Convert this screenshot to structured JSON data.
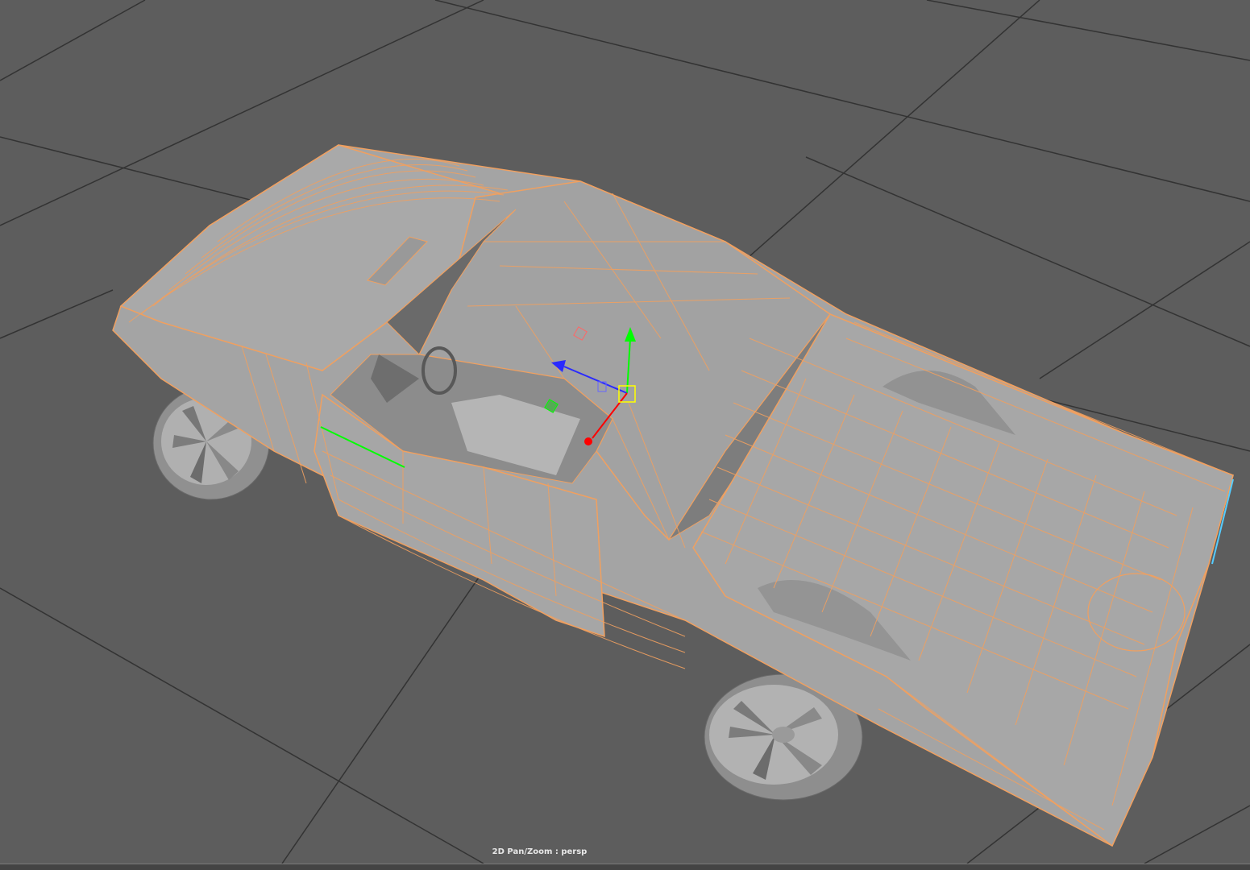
{
  "viewport": {
    "status_label": "2D Pan/Zoom : persp",
    "camera": "persp"
  },
  "colors": {
    "background": "#5d5d5d",
    "grid": "#333333",
    "wireframe": "#f0a060",
    "mesh": "#a8a8a8",
    "mesh_dark": "#7a7a7a",
    "axis_x": "#ff0000",
    "axis_y": "#00ff00",
    "axis_z": "#0000ff",
    "pivot": "#ffff00",
    "selection_edge": "#00ff00",
    "highlight_edge": "#55ccff"
  },
  "icons": {
    "manipulator": "move-manipulator-icon"
  }
}
